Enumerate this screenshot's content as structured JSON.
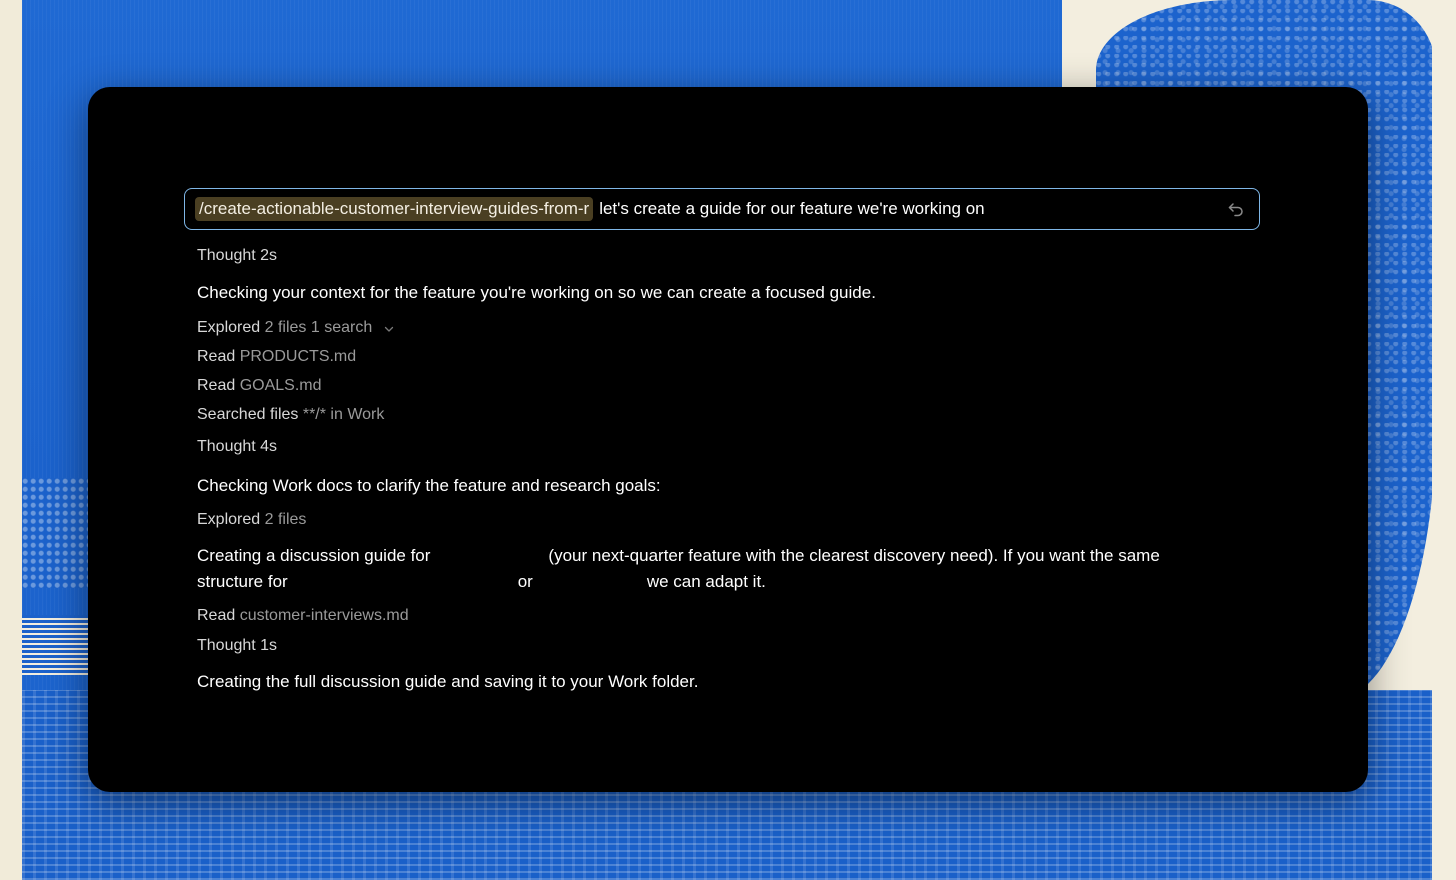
{
  "prompt": {
    "command": "/create-actionable-customer-interview-guides-from-r",
    "text": "let's create a guide for our feature we're working on"
  },
  "log": {
    "thought_1": "Thought 2s",
    "message_1": "Checking your context for the feature you're working on so we can create a focused guide.",
    "explored_1": {
      "label": "Explored",
      "detail": "2 files 1 search"
    },
    "read_1": {
      "label": "Read",
      "detail": "PRODUCTS.md"
    },
    "read_2": {
      "label": "Read",
      "detail": "GOALS.md"
    },
    "searched": {
      "label": "Searched files",
      "detail": "**/* in Work"
    },
    "thought_2": "Thought 4s",
    "message_2": "Checking Work docs to clarify the feature and research goals:",
    "explored_2": {
      "label": "Explored",
      "detail": "2 files"
    },
    "message_3": {
      "part1": "Creating a discussion guide for",
      "part2": "(your next-quarter feature with the clearest discovery need). If you want the same",
      "part3": "structure for",
      "part4": "or",
      "part5": "we can adapt it."
    },
    "read_3": {
      "label": "Read",
      "detail": "customer-interviews.md"
    },
    "thought_3": "Thought 1s",
    "message_4": "Creating the full discussion guide and saving it to your Work folder."
  },
  "colors": {
    "window_bg": "#000000",
    "prompt_border": "#7fb6e6",
    "command_chip": "#4a3f22",
    "wallpaper_blue": "#1f69d3",
    "wallpaper_cream": "#f3eedf"
  }
}
